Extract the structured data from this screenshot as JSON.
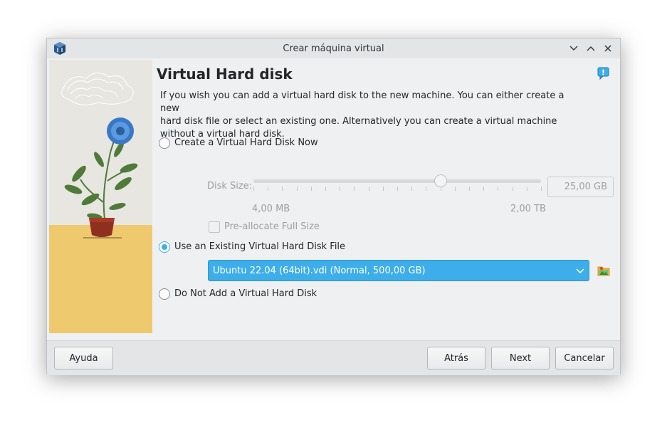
{
  "window": {
    "title": "Crear máquina virtual",
    "minimize_icon": "chevron-down-icon",
    "maximize_icon": "chevron-up-icon",
    "close_icon": "close-icon"
  },
  "page": {
    "title": "Virtual Hard disk",
    "description_lines": [
      "If you wish you can add a virtual hard disk to the new machine. You can either create a new",
      "hard disk file or select an existing one. Alternatively you can create a virtual machine",
      "without a virtual hard disk."
    ]
  },
  "options": {
    "create_now": {
      "label": "Create a Virtual Hard Disk Now",
      "selected": false
    },
    "disk_size": {
      "label": "Disk Size:",
      "value": "25,00 GB",
      "min_label": "4,00 MB",
      "max_label": "2,00 TB",
      "slider_fraction": 0.65,
      "enabled": false
    },
    "preallocate": {
      "label": "Pre-allocate Full Size",
      "checked": false,
      "enabled": false
    },
    "use_existing": {
      "label": "Use an Existing Virtual Hard Disk File",
      "selected": true,
      "file": "Ubuntu 22.04 (64bit).vdi (Normal, 500,00 GB)"
    },
    "no_disk": {
      "label": "Do Not Add a Virtual Hard Disk",
      "selected": false
    }
  },
  "buttons": {
    "help": "Ayuda",
    "back": "Atrás",
    "next": "Next",
    "cancel": "Cancelar"
  },
  "colors": {
    "accent": "#3daee9",
    "window_bg": "#eff0f1"
  }
}
